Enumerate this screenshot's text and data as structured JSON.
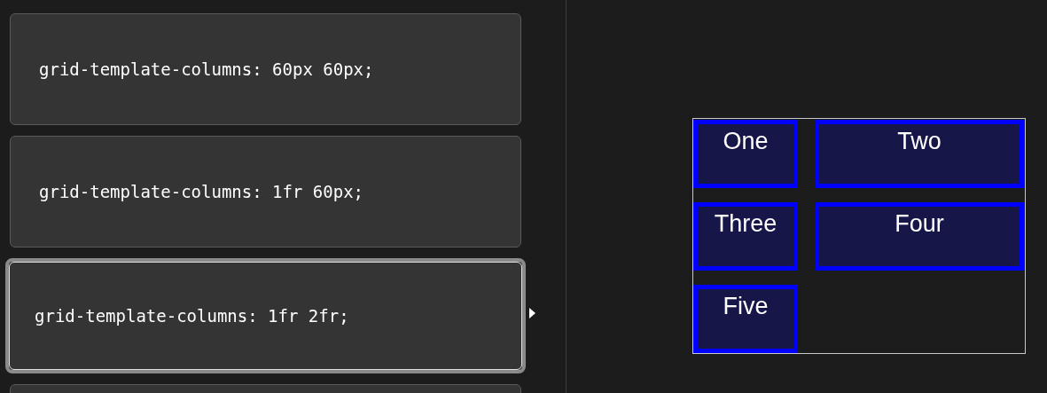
{
  "options": [
    {
      "code": "grid-template-columns: 60px 60px;",
      "selected": false
    },
    {
      "code": "grid-template-columns: 1fr 60px;",
      "selected": false
    },
    {
      "code": "grid-template-columns: 1fr 2fr;",
      "selected": true
    }
  ],
  "preview": {
    "items": [
      "One",
      "Two",
      "Three",
      "Four",
      "Five"
    ]
  }
}
